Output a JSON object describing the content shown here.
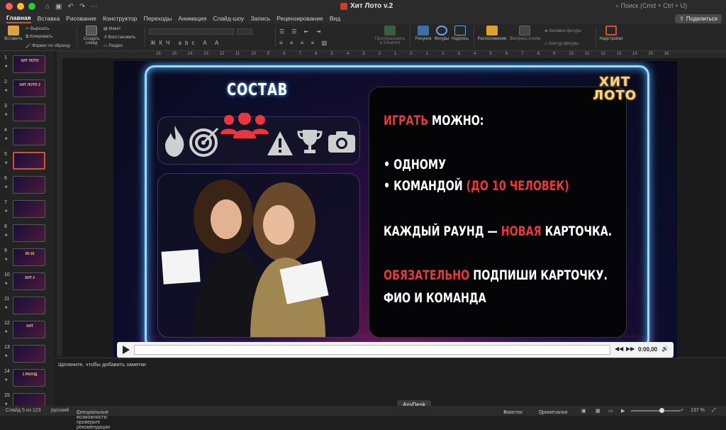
{
  "window": {
    "title": "Хит Лото v.2",
    "search_placeholder": "Поиск (Cmd + Ctrl + U)",
    "share_label": "Поделиться"
  },
  "menu": [
    "Главная",
    "Вставка",
    "Рисование",
    "Конструктор",
    "Переходы",
    "Анимация",
    "Слайд-шоу",
    "Запись",
    "Рецензирование",
    "Вид"
  ],
  "ribbon": {
    "paste": "Вставить",
    "cut": "Вырезать",
    "copy": "Копировать",
    "format_painter": "Формат по образцу",
    "new_slide_1": "Создать",
    "new_slide_2": "слайд",
    "layout": "Макет",
    "reset": "Восстановить",
    "section": "Раздел",
    "smartart_1": "Преобразовать",
    "smartart_2": "в SmartArt",
    "picture": "Рисунок",
    "shapes": "Фигуры",
    "textbox": "Надпись",
    "arrange": "Расположение",
    "quick_styles": "Экспресс-стили",
    "shape_fill": "Заливка фигуры",
    "shape_outline": "Контур фигуры",
    "addins": "Надстройки"
  },
  "ruler_labels": [
    "16",
    "15",
    "14",
    "13",
    "12",
    "11",
    "10",
    "9",
    "8",
    "7",
    "6",
    "5",
    "4",
    "3",
    "2",
    "1",
    "0",
    "1",
    "2",
    "3",
    "4",
    "5",
    "6",
    "7",
    "8",
    "9",
    "10",
    "11",
    "12",
    "13",
    "14",
    "15",
    "16"
  ],
  "thumbnails": [
    {
      "num": "1",
      "label": "ХИТ ЛОТО"
    },
    {
      "num": "2",
      "label": "ХИТ ЛОТО 2"
    },
    {
      "num": "3",
      "label": ""
    },
    {
      "num": "4",
      "label": ""
    },
    {
      "num": "5",
      "label": ""
    },
    {
      "num": "6",
      "label": ""
    },
    {
      "num": "7",
      "label": ""
    },
    {
      "num": "8",
      "label": ""
    },
    {
      "num": "9",
      "label": "00:16"
    },
    {
      "num": "10",
      "label": "ХИТ 2"
    },
    {
      "num": "11",
      "label": ""
    },
    {
      "num": "12",
      "label": "ХИТ"
    },
    {
      "num": "13",
      "label": ""
    },
    {
      "num": "14",
      "label": "1 РАУНД"
    },
    {
      "num": "15",
      "label": ""
    }
  ],
  "slide": {
    "sostav": "СОСТАВ",
    "logo_line1": "ХИТ",
    "logo_line2": "ЛОТО",
    "l1_red": "ИГРАТЬ",
    "l1_white": " МОЖНО:",
    "l2": "• ОДНОМУ",
    "l3_white": "• КОМАНДОЙ ",
    "l3_red": "(ДО 10 ЧЕЛОВЕК)",
    "l4_a": "КАЖДЫЙ РАУНД — ",
    "l4_red": "НОВАЯ",
    "l4_b": " КАРТОЧКА.",
    "l5_red": "ОБЯЗАТЕЛЬНО",
    "l5_white": " ПОДПИШИ КАРТОЧКУ.",
    "l6": "ФИО И КОМАНДА",
    "icons": [
      "fire-icon",
      "target-icon",
      "team-icon",
      "warning-icon",
      "trophy-icon",
      "camera-icon"
    ]
  },
  "player": {
    "time": "0:00,00"
  },
  "notes_placeholder": "Щелкните, чтобы добавить заметки",
  "status": {
    "slide_info": "Слайд 5 из 123",
    "language": "русский",
    "accessibility": "Специальные возможности: проверьте рекомендации",
    "notes_btn": "Заметки",
    "comments_btn": "Примечания",
    "zoom": "137 %"
  },
  "anydesk": "AnyDesk",
  "colors": {
    "accent": "#d35230",
    "red_text": "#e8383d",
    "neon_blue": "#9cd9ff",
    "neon_pink": "#ff4fb8",
    "logo_gold": "#f4d58a"
  }
}
